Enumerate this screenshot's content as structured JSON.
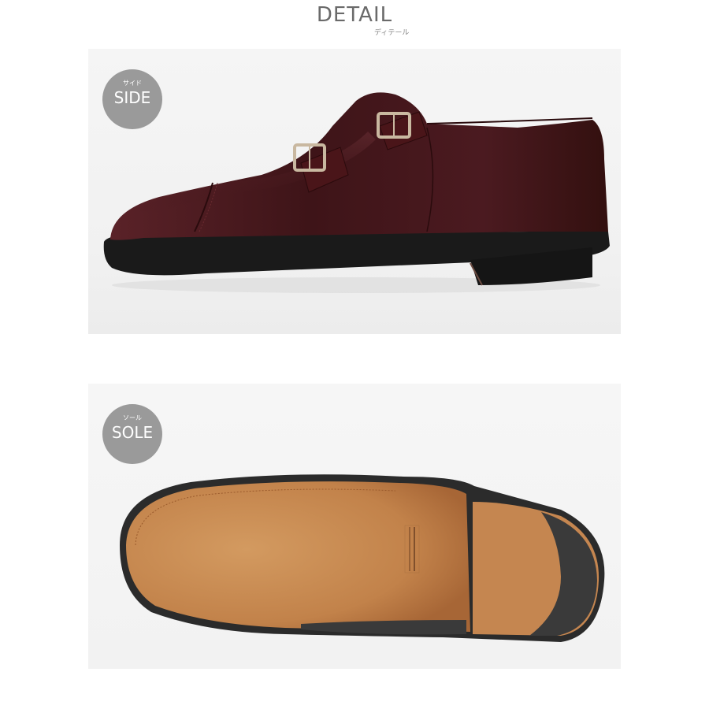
{
  "header": {
    "title": "DETAIL",
    "subtitle": "ディテール"
  },
  "panels": [
    {
      "badge_sub": "サイド",
      "badge_label": "SIDE"
    },
    {
      "badge_sub": "ソール",
      "badge_label": "SOLE"
    }
  ],
  "colors": {
    "leather": "#4a1a1f",
    "sole_leather": "#c88a52",
    "heel_rubber": "#2f2f2f",
    "badge": "#9a9a9a"
  },
  "icons": {
    "buckle": "buckle-icon"
  }
}
